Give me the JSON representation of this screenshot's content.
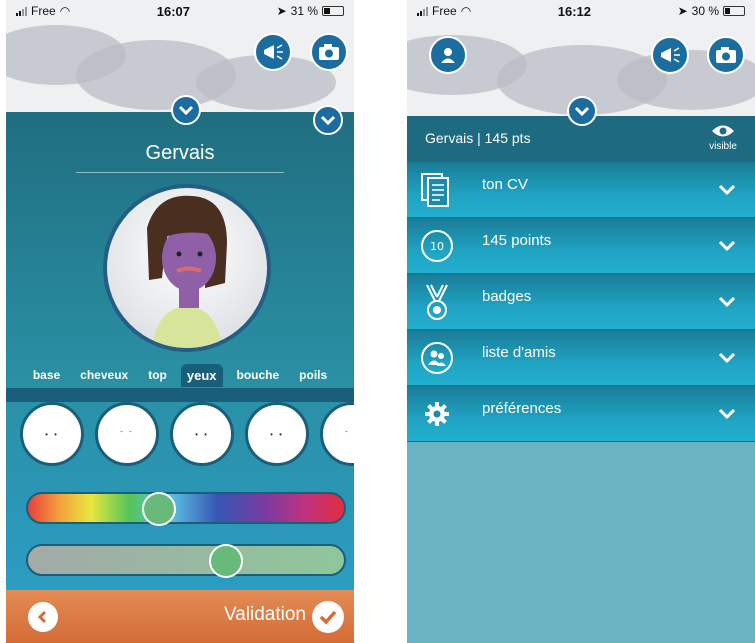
{
  "left": {
    "status": {
      "carrier": "Free",
      "time": "16:07",
      "battery": "31 %",
      "battery_level": 0.31
    },
    "name": "Gervais",
    "tabs": [
      {
        "label": "base",
        "active": false
      },
      {
        "label": "cheveux",
        "active": false
      },
      {
        "label": "top",
        "active": false
      },
      {
        "label": "yeux",
        "active": true
      },
      {
        "label": "bouche",
        "active": false
      },
      {
        "label": "poils",
        "active": false
      }
    ],
    "color_slider_value": 0.41,
    "tone_slider_value": 0.65,
    "footer": {
      "validate_label": "Validation"
    }
  },
  "right": {
    "status": {
      "carrier": "Free",
      "time": "16:12",
      "battery": "30 %",
      "battery_level": 0.3
    },
    "user_line": "Gervais | 145 pts",
    "visibility_label": "visible",
    "menu": [
      {
        "label": "ton CV",
        "icon": "cv-document-icon"
      },
      {
        "label": "145 points",
        "icon": "points-badge-icon",
        "icon_text": "10"
      },
      {
        "label": "badges",
        "icon": "medal-icon"
      },
      {
        "label": "liste d'amis",
        "icon": "friends-icon"
      },
      {
        "label": "préférences",
        "icon": "gear-icon"
      }
    ]
  },
  "colors": {
    "teal_dark": "#1e6a80",
    "teal": "#23afd0",
    "orange": "#d9753d",
    "green_knob": "#67ba7a"
  }
}
